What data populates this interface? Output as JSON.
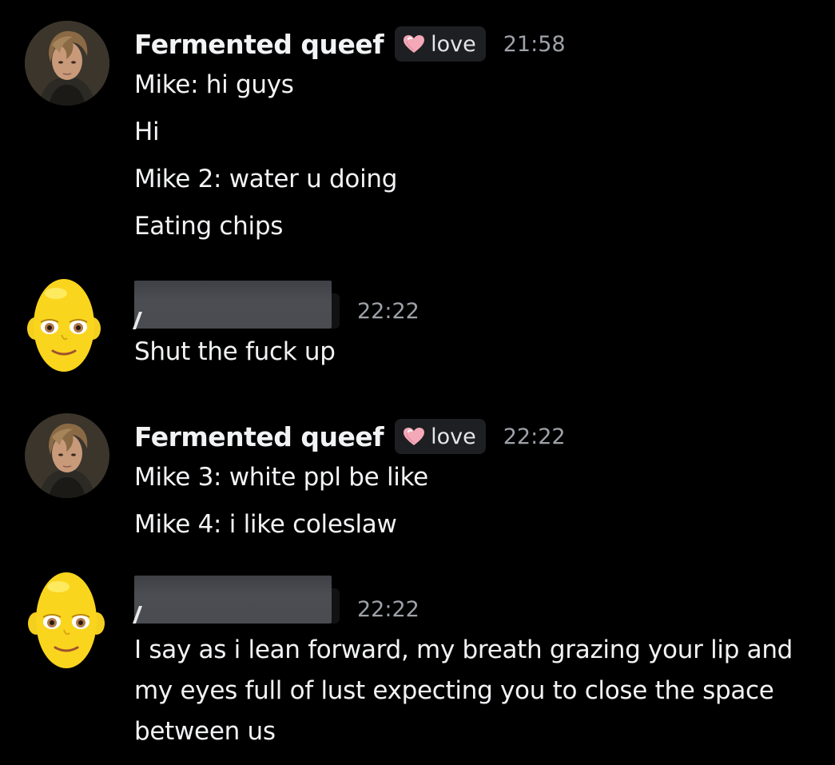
{
  "messages": [
    {
      "author": "Fermented queef",
      "tag": "love",
      "time": "21:58",
      "lines": [
        "Mike: hi guys",
        "Hi",
        "Mike 2: water u doing",
        "Eating chips"
      ]
    },
    {
      "author": "",
      "time": "22:22",
      "lines": [
        "Shut the fuck up"
      ]
    },
    {
      "author": "Fermented queef",
      "tag": "love",
      "time": "22:22",
      "lines": [
        "Mike 3: white ppl be like",
        "Mike 4: i like coleslaw"
      ]
    },
    {
      "author": "",
      "time": "22:22",
      "lines": [
        "I say as i lean forward, my breath grazing your lip and my eyes full of lust expecting you to close the space between us"
      ]
    }
  ],
  "colors": {
    "background": "#000000",
    "text": "#f2f3f5",
    "timestamp": "#9ea2a8",
    "tag_bg": "#1e1f22",
    "heart": "#f4a9b8"
  },
  "icons": {
    "tag_icon": "heart-icon",
    "avatar_1": "game-character-avatar",
    "avatar_2": "yellow-emoji-face-avatar"
  }
}
